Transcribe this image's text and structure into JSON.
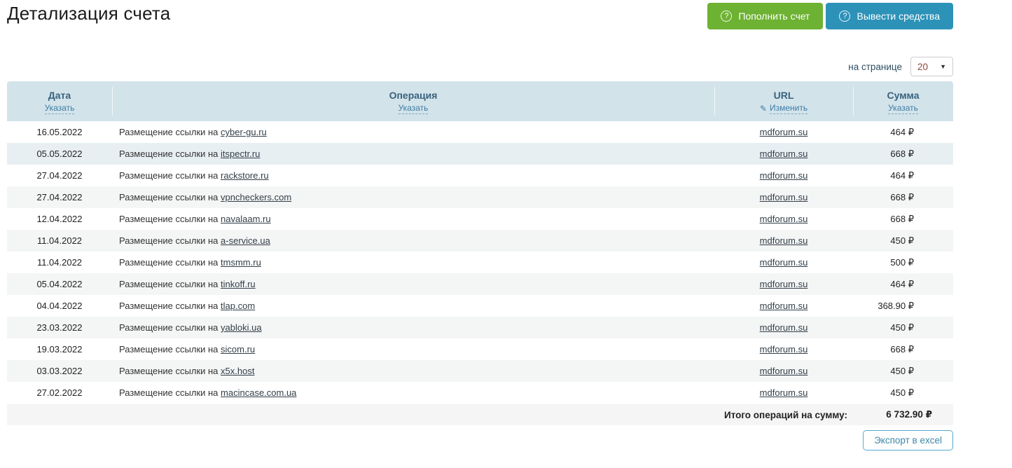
{
  "page": {
    "title": "Детализация счета"
  },
  "header_buttons": {
    "topup_label": "Пополнить счет",
    "withdraw_label": "Вывести средства",
    "icon": "question-circle"
  },
  "pagination": {
    "label": "на странице",
    "per_page": "20"
  },
  "table": {
    "columns": [
      {
        "label": "Дата",
        "action": "Указать"
      },
      {
        "label": "Операция",
        "action": "Указать"
      },
      {
        "label": "URL",
        "action": "Изменить",
        "icon": "pencil-icon"
      },
      {
        "label": "Сумма",
        "action": "Указать"
      }
    ],
    "operation_prefix": "Размещение ссылки на",
    "rows": [
      {
        "date": "16.05.2022",
        "site": "cyber-gu.ru",
        "url": "mdforum.su",
        "amount": "464 ₽"
      },
      {
        "date": "05.05.2022",
        "site": "itspectr.ru",
        "url": "mdforum.su",
        "amount": "668 ₽",
        "highlight": true
      },
      {
        "date": "27.04.2022",
        "site": "rackstore.ru",
        "url": "mdforum.su",
        "amount": "464 ₽"
      },
      {
        "date": "27.04.2022",
        "site": "vpncheckers.com",
        "url": "mdforum.su",
        "amount": "668 ₽"
      },
      {
        "date": "12.04.2022",
        "site": "navalaam.ru",
        "url": "mdforum.su",
        "amount": "668 ₽"
      },
      {
        "date": "11.04.2022",
        "site": "a-service.ua",
        "url": "mdforum.su",
        "amount": "450 ₽"
      },
      {
        "date": "11.04.2022",
        "site": "tmsmm.ru",
        "url": "mdforum.su",
        "amount": "500 ₽"
      },
      {
        "date": "05.04.2022",
        "site": "tinkoff.ru",
        "url": "mdforum.su",
        "amount": "464 ₽"
      },
      {
        "date": "04.04.2022",
        "site": "tlap.com",
        "url": "mdforum.su",
        "amount": "368.90 ₽"
      },
      {
        "date": "23.03.2022",
        "site": "yabloki.ua",
        "url": "mdforum.su",
        "amount": "450 ₽"
      },
      {
        "date": "19.03.2022",
        "site": "sicom.ru",
        "url": "mdforum.su",
        "amount": "668 ₽"
      },
      {
        "date": "03.03.2022",
        "site": "x5x.host",
        "url": "mdforum.su",
        "amount": "450 ₽"
      },
      {
        "date": "27.02.2022",
        "site": "macincase.com.ua",
        "url": "mdforum.su",
        "amount": "450 ₽"
      }
    ],
    "total_label": "Итого операций на сумму:",
    "total_amount": "6 732.90 ₽"
  },
  "footer": {
    "export_label": "Экспорт в excel"
  },
  "colors": {
    "topup_green": "#6db232",
    "withdraw_blue": "#2d92b8",
    "table_header_bg": "#d3e3ea",
    "table_header_text": "#38627f",
    "action_link": "#3d7ea6",
    "row_alt_bg": "#f4f5f5",
    "row_highlight_bg": "#e8eff3",
    "total_row_bg": "#f5f5f5",
    "export_border": "#55a9cd"
  }
}
